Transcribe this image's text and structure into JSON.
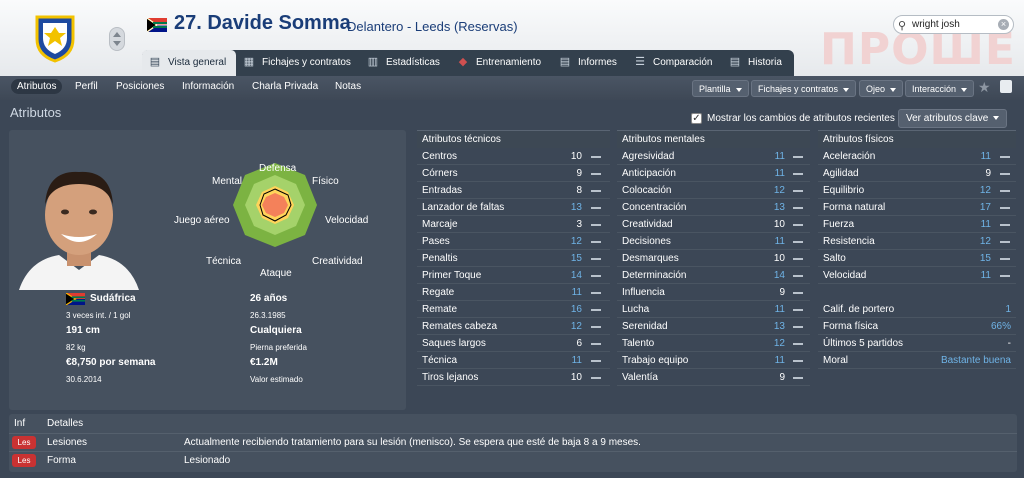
{
  "header": {
    "player_title": "27. Davide Somma",
    "position_club": "Delantero - Leeds (Reservas)",
    "watermark": "ПРОШЕ",
    "search_value": "wright josh"
  },
  "tabs": [
    {
      "label": "Vista general",
      "icon": "overview-icon",
      "active": true
    },
    {
      "label": "Fichajes y contratos",
      "icon": "contract-icon"
    },
    {
      "label": "Estadísticas",
      "icon": "stats-icon"
    },
    {
      "label": "Entrenamiento",
      "icon": "training-icon"
    },
    {
      "label": "Informes",
      "icon": "reports-icon"
    },
    {
      "label": "Comparación",
      "icon": "compare-icon"
    },
    {
      "label": "Historia",
      "icon": "history-icon"
    }
  ],
  "subnav": [
    "Atributos",
    "Perfil",
    "Posiciones",
    "Información",
    "Charla Privada",
    "Notas"
  ],
  "subnav_dropdowns": [
    "Plantilla",
    "Fichajes y contratos",
    "Ojeo",
    "Interacción"
  ],
  "section": {
    "title": "Atributos",
    "checkbox_label": "Mostrar los cambios de atributos recientes",
    "checkbox_checked": true,
    "view_button": "Ver atributos clave"
  },
  "radar_labels": {
    "top": "Defensa",
    "top_left": "Mental",
    "top_right": "Físico",
    "left": "Juego aéreo",
    "right": "Velocidad",
    "bottom_left": "Técnica",
    "bottom_right": "Creatividad",
    "bottom": "Ataque"
  },
  "profile": {
    "nation": "Sudáfrica",
    "caps": "3 veces int. / 1 gol",
    "height": "191 cm",
    "weight": "82 kg",
    "wage": "€8,750 por semana",
    "contract_end": "30.6.2014",
    "age": "26 años",
    "dob": "26.3.1985",
    "foot": "Cualquiera",
    "foot_label": "Pierna preferida",
    "value": "€1.2M",
    "value_label": "Valor estimado"
  },
  "technical": {
    "header": "Atributos técnicos",
    "items": [
      [
        "Centros",
        "10"
      ],
      [
        "Córners",
        "9"
      ],
      [
        "Entradas",
        "8"
      ],
      [
        "Lanzador de faltas",
        "13"
      ],
      [
        "Marcaje",
        "3"
      ],
      [
        "Pases",
        "12"
      ],
      [
        "Penaltis",
        "15"
      ],
      [
        "Primer Toque",
        "14"
      ],
      [
        "Regate",
        "11"
      ],
      [
        "Remate",
        "16"
      ],
      [
        "Remates cabeza",
        "12"
      ],
      [
        "Saques largos",
        "6"
      ],
      [
        "Técnica",
        "11"
      ],
      [
        "Tiros lejanos",
        "10"
      ]
    ]
  },
  "mental": {
    "header": "Atributos mentales",
    "items": [
      [
        "Agresividad",
        "11"
      ],
      [
        "Anticipación",
        "11"
      ],
      [
        "Colocación",
        "12"
      ],
      [
        "Concentración",
        "13"
      ],
      [
        "Creatividad",
        "10"
      ],
      [
        "Decisiones",
        "11"
      ],
      [
        "Desmarques",
        "10"
      ],
      [
        "Determinación",
        "14"
      ],
      [
        "Influencia",
        "9"
      ],
      [
        "Lucha",
        "11"
      ],
      [
        "Serenidad",
        "13"
      ],
      [
        "Talento",
        "12"
      ],
      [
        "Trabajo equipo",
        "11"
      ],
      [
        "Valentía",
        "9"
      ]
    ]
  },
  "physical": {
    "header": "Atributos físicos",
    "items": [
      [
        "Aceleración",
        "11"
      ],
      [
        "Agilidad",
        "9"
      ],
      [
        "Equilibrio",
        "12"
      ],
      [
        "Forma natural",
        "17"
      ],
      [
        "Fuerza",
        "11"
      ],
      [
        "Resistencia",
        "12"
      ],
      [
        "Salto",
        "15"
      ],
      [
        "Velocidad",
        "11"
      ]
    ],
    "extra": [
      [
        "Calif. de portero",
        "1"
      ],
      [
        "Forma física",
        "66%"
      ],
      [
        "Últimos 5 partidos",
        "-"
      ],
      [
        "Moral",
        "Bastante buena"
      ]
    ]
  },
  "details": {
    "inf_header": "Inf",
    "details_header": "Detalles",
    "rows": [
      {
        "badge": "Les",
        "type": "Lesiones",
        "text": "Actualmente recibiendo tratamiento para su lesión (menisco). Se espera que esté de baja 8 a 9 meses."
      },
      {
        "badge": "Les",
        "type": "Forma",
        "text": "Lesionado"
      }
    ]
  },
  "colors": {
    "accent_blue": "#6fb3e6",
    "injury_red": "#c93232",
    "title_blue": "#1a3d78"
  }
}
